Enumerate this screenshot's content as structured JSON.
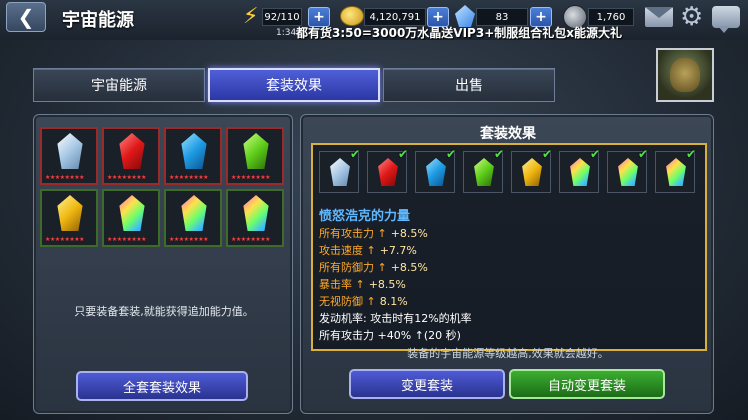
{
  "header": {
    "back_icon": "back-arrow-icon",
    "title": "宇宙能源",
    "energy": "92/110",
    "energy_timer": "1:34",
    "gold": "4,120,791",
    "crystals": "83",
    "tokens": "1,760",
    "plus_label": "+",
    "ticker": "都有货3:50=3000万水晶送VIP3+制服组合礼包x能源大礼"
  },
  "tabs": [
    {
      "label": "宇宙能源",
      "active": false
    },
    {
      "label": "套装效果",
      "active": true
    },
    {
      "label": "出售",
      "active": false
    }
  ],
  "left_panel": {
    "gems": [
      {
        "color": "white",
        "stars": "★★★★★★★★"
      },
      {
        "color": "red",
        "stars": "★★★★★★★★"
      },
      {
        "color": "blue",
        "stars": "★★★★★★★★"
      },
      {
        "color": "green",
        "stars": "★★★★★★★★"
      },
      {
        "color": "yellow",
        "stars": "★★★★★★★★"
      },
      {
        "color": "rainbow",
        "stars": "★★★★★★★★"
      },
      {
        "color": "rainbow",
        "stars": "★★★★★★★★"
      },
      {
        "color": "rainbow",
        "stars": "★★★★★★★★"
      }
    ],
    "hint": "只要装备套装,就能获得追加能力值。",
    "button_label": "全套套装效果"
  },
  "right_panel": {
    "title": "套装效果",
    "check_icon": "✔",
    "set_gems": [
      "white",
      "red",
      "blue",
      "green",
      "yellow",
      "rainbow",
      "rainbow",
      "rainbow"
    ],
    "set_name": "愤怒浩克的力量",
    "stats": [
      {
        "label": "所有攻击力 ↑",
        "value": "+8.5%"
      },
      {
        "label": "攻击速度 ↑",
        "value": "+7.7%"
      },
      {
        "label": "所有防御力 ↑",
        "value": "+8.5%"
      },
      {
        "label": "暴击率 ↑",
        "value": "+8.5%"
      },
      {
        "label": "无视防御 ↑",
        "value": "8.1%"
      }
    ],
    "extra_lines": [
      "发动机率: 攻击时有12%的机率",
      "所有攻击力 +40% ↑(20 秒)"
    ],
    "hint": "装备的宇宙能源等级越高,效果就会越好。",
    "change_button": "变更套装",
    "auto_button": "自动变更套装"
  },
  "colors": {
    "accent_blue": "#3b45c0",
    "accent_green": "#2f9a26",
    "gold_border": "#d9b038",
    "stat_orange": "#ffa928"
  }
}
